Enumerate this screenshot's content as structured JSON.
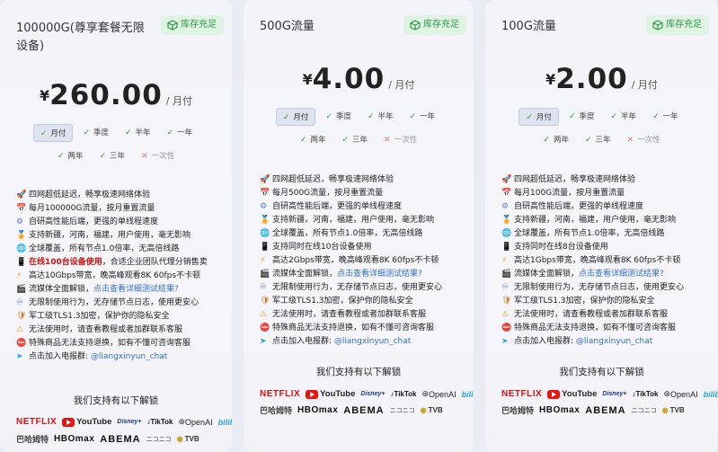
{
  "cards": [
    {
      "title": "100000G(尊享套餐无限设备)",
      "stock": "库存充足",
      "price_symbol": "¥",
      "price": "260.00",
      "price_unit": "/ 月付",
      "periods_row1": [
        {
          "label": "月付",
          "state": "active"
        },
        {
          "label": "季度",
          "state": "ok"
        },
        {
          "label": "半年",
          "state": "ok"
        },
        {
          "label": "一年",
          "state": "ok"
        }
      ],
      "periods_row2": [
        {
          "label": "两年",
          "state": "ok"
        },
        {
          "label": "三年",
          "state": "ok"
        },
        {
          "label": "一次性",
          "state": "disabled"
        }
      ],
      "features": [
        {
          "icon": "rocket-icon",
          "text": "四网超低延迟，畅享极速网络体验"
        },
        {
          "icon": "calendar-icon",
          "text": "每月100000G流量，按月重置流量"
        },
        {
          "icon": "gear-icon",
          "text": "自研高性能后端，更强的单线程速度"
        },
        {
          "icon": "medal-icon",
          "text": "支持新疆，河南，福建，用户使用，毫无影响"
        },
        {
          "icon": "globe-icon",
          "text": "全球覆盖，所有节点1.0倍率，无高倍线路"
        },
        {
          "icon": "device-icon",
          "text": "在线100台设备使用",
          "text_suffix": "，合适企业团队代理分销售卖",
          "highlight": true
        },
        {
          "icon": "bolt-icon",
          "text": "高达10Gbps带宽，晚高峰观看8K 60fps不卡顿"
        },
        {
          "icon": "film-icon",
          "text": "流媒体全面解锁，",
          "link": "点击查看详细测试结果?"
        },
        {
          "icon": "unlimited-icon",
          "text": "无限制使用行为，无存储节点日志，使用更安心"
        },
        {
          "icon": "shield-icon",
          "text": "军工级TLS1.3加密，保护你的隐私安全"
        },
        {
          "icon": "warning-icon",
          "text": "无法使用时，请查看教程或者加群联系客服"
        },
        {
          "icon": "ban-icon",
          "text": "特殊商品无法支持退换，如有不懂可咨询客服"
        },
        {
          "icon": "telegram-icon",
          "text": "点击加入电报群: ",
          "link": "@liangxinyun_chat"
        }
      ],
      "unlock_title": "我们支持有以下解锁"
    },
    {
      "title": "500G流量",
      "stock": "库存充足",
      "price_symbol": "¥",
      "price": "4.00",
      "price_unit": "/ 月付",
      "periods_row1": [
        {
          "label": "月付",
          "state": "active"
        },
        {
          "label": "季度",
          "state": "ok"
        },
        {
          "label": "半年",
          "state": "ok"
        },
        {
          "label": "一年",
          "state": "ok"
        }
      ],
      "periods_row2": [
        {
          "label": "两年",
          "state": "ok"
        },
        {
          "label": "三年",
          "state": "ok"
        },
        {
          "label": "一次性",
          "state": "disabled"
        }
      ],
      "features": [
        {
          "icon": "rocket-icon",
          "text": "四网超低延迟，畅享极速网络体验"
        },
        {
          "icon": "calendar-icon",
          "text": "每月500G流量，按月重置流量"
        },
        {
          "icon": "gear-icon",
          "text": "自研高性能后端，更强的单线程速度"
        },
        {
          "icon": "medal-icon",
          "text": "支持新疆，河南，福建，用户使用，毫无影响"
        },
        {
          "icon": "globe-icon",
          "text": "全球覆盖，所有节点1.0倍率，无高倍线路"
        },
        {
          "icon": "device-icon",
          "text": "支持同时在线10台设备使用"
        },
        {
          "icon": "bolt-icon",
          "text": "高达2Gbps带宽，晚高峰观看8K 60fps不卡顿"
        },
        {
          "icon": "film-icon",
          "text": "流媒体全面解锁，",
          "link": "点击查看详细测试结果?"
        },
        {
          "icon": "unlimited-icon",
          "text": "无限制使用行为，无存储节点日志，使用更安心"
        },
        {
          "icon": "shield-icon",
          "text": "军工级TLS1.3加密，保护你的隐私安全"
        },
        {
          "icon": "warning-icon",
          "text": "无法使用时，请查看教程或者加群联系客服"
        },
        {
          "icon": "ban-icon",
          "text": "特殊商品无法支持退换，如有不懂可咨询客服"
        },
        {
          "icon": "telegram-icon",
          "text": "点击加入电报群: ",
          "link": "@liangxinyun_chat"
        }
      ],
      "unlock_title": "我们支持有以下解锁"
    },
    {
      "title": "100G流量",
      "stock": "库存充足",
      "price_symbol": "¥",
      "price": "2.00",
      "price_unit": "/ 月付",
      "periods_row1": [
        {
          "label": "月付",
          "state": "active"
        },
        {
          "label": "季度",
          "state": "ok"
        },
        {
          "label": "半年",
          "state": "ok"
        },
        {
          "label": "一年",
          "state": "ok"
        }
      ],
      "periods_row2": [
        {
          "label": "两年",
          "state": "ok"
        },
        {
          "label": "三年",
          "state": "ok"
        },
        {
          "label": "一次性",
          "state": "disabled"
        }
      ],
      "features": [
        {
          "icon": "rocket-icon",
          "text": "四网超低延迟，畅享极速网络体验"
        },
        {
          "icon": "calendar-icon",
          "text": "每月100G流量，按月重置流量"
        },
        {
          "icon": "gear-icon",
          "text": "自研高性能后端，更强的单线程速度"
        },
        {
          "icon": "medal-icon",
          "text": "支持新疆，河南，福建，用户使用，毫无影响"
        },
        {
          "icon": "globe-icon",
          "text": "全球覆盖，所有节点1.0倍率，无高倍线路"
        },
        {
          "icon": "device-icon",
          "text": "支持同时在线8台设备使用"
        },
        {
          "icon": "bolt-icon",
          "text": "高达1Gbps带宽，晚高峰观看8K 60fps不卡顿"
        },
        {
          "icon": "film-icon",
          "text": "流媒体全面解锁，",
          "link": "点击查看详细测试结果?"
        },
        {
          "icon": "unlimited-icon",
          "text": "无限制使用行为，无存储节点日志，使用更安心"
        },
        {
          "icon": "shield-icon",
          "text": "军工级TLS1.3加密，保护你的隐私安全"
        },
        {
          "icon": "warning-icon",
          "text": "无法使用时，请查看教程或者加群联系客服"
        },
        {
          "icon": "ban-icon",
          "text": "特殊商品无法支持退换，如有不懂可咨询客服"
        },
        {
          "icon": "telegram-icon",
          "text": "点击加入电报群: ",
          "link": "@liangxinyun_chat"
        }
      ],
      "unlock_title": "我们支持有以下解锁"
    }
  ],
  "logos_row1": [
    "NETFLIX",
    "YouTube",
    "Disney+",
    "TikTok",
    "OpenAI",
    "bilibili"
  ],
  "logos_row2": [
    "巴哈姆特",
    "HBOmax",
    "ABEMA",
    "ニコニコ",
    "TVB"
  ],
  "colors": {
    "accent_green": "#2f9a48",
    "badge_bg": "#dff3e2",
    "highlight_red": "#c11",
    "link_blue": "#2f6fd6",
    "card_bg": "#f3f4f8",
    "page_bg": "#e9ecf3"
  }
}
